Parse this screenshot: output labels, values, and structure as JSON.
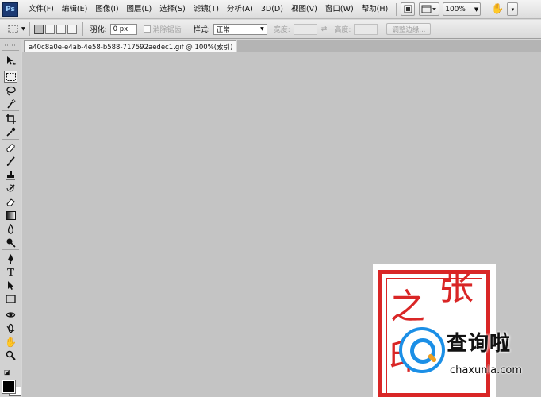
{
  "app": {
    "logo_text": "Ps"
  },
  "menu": {
    "items": [
      "文件(F)",
      "编辑(E)",
      "图像(I)",
      "图层(L)",
      "选择(S)",
      "滤镜(T)",
      "分析(A)",
      "3D(D)",
      "视图(V)",
      "窗口(W)",
      "帮助(H)"
    ],
    "zoom_value": "100%",
    "icons": [
      "bridge-icon",
      "screen-mode-icon",
      "hand-icon"
    ]
  },
  "options": {
    "feather_label": "羽化:",
    "feather_value": "0 px",
    "antialias_label": "消除锯齿",
    "style_label": "样式:",
    "style_value": "正常",
    "width_label": "宽度:",
    "height_label": "高度:",
    "refine_edge_label": "调整边缘..."
  },
  "document": {
    "tab_title": "a40c8a0e-e4ab-4e58-b588-717592aedec1.gif @ 100%(索引)",
    "close_symbol": "×"
  },
  "seal": {
    "chars": [
      "之",
      "张",
      "印"
    ],
    "color": "#d92626"
  },
  "watermark": {
    "title": "查询啦",
    "url": "chaxunla.com",
    "accent": "#1b8fe6"
  },
  "colors": {
    "canvas_bg": "#c4c4c4",
    "foreground": "#000000",
    "background": "#ffffff"
  }
}
